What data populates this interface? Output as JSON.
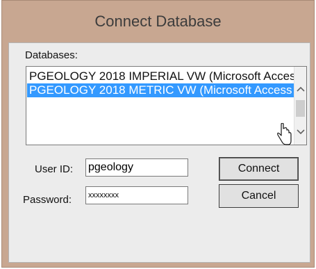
{
  "dialog": {
    "title": "Connect Database"
  },
  "databases": {
    "label": "Databases:",
    "items": [
      {
        "text": "PGEOLOGY 2018 IMPERIAL VW (Microsoft Access",
        "selected": false
      },
      {
        "text": "PGEOLOGY 2018 METRIC VW (Microsoft Access",
        "selected": true
      }
    ]
  },
  "user_id": {
    "label": "User ID:",
    "value": "pgeology"
  },
  "password": {
    "label": "Password:",
    "value": "xxxxxxxx"
  },
  "buttons": {
    "connect": "Connect",
    "cancel": "Cancel"
  },
  "icons": {
    "scroll_up": "chevron-up-icon",
    "scroll_down": "chevron-down-icon",
    "cursor": "hand-pointer-icon"
  },
  "colors": {
    "titlebar": "#c8a791",
    "selection": "#3399ff",
    "client": "#ececec"
  }
}
